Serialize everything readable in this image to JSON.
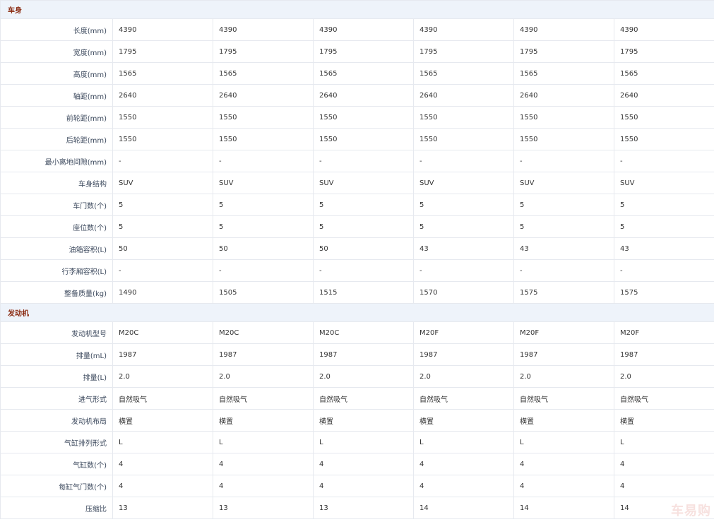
{
  "watermark": "车易购",
  "sections": [
    {
      "title": "车身",
      "rows": [
        {
          "label": "长度(mm)",
          "values": [
            "4390",
            "4390",
            "4390",
            "4390",
            "4390",
            "4390"
          ]
        },
        {
          "label": "宽度(mm)",
          "values": [
            "1795",
            "1795",
            "1795",
            "1795",
            "1795",
            "1795"
          ]
        },
        {
          "label": "高度(mm)",
          "values": [
            "1565",
            "1565",
            "1565",
            "1565",
            "1565",
            "1565"
          ]
        },
        {
          "label": "轴距(mm)",
          "values": [
            "2640",
            "2640",
            "2640",
            "2640",
            "2640",
            "2640"
          ]
        },
        {
          "label": "前轮距(mm)",
          "values": [
            "1550",
            "1550",
            "1550",
            "1550",
            "1550",
            "1550"
          ]
        },
        {
          "label": "后轮距(mm)",
          "values": [
            "1550",
            "1550",
            "1550",
            "1550",
            "1550",
            "1550"
          ]
        },
        {
          "label": "最小离地间隙(mm)",
          "values": [
            "-",
            "-",
            "-",
            "-",
            "-",
            "-"
          ]
        },
        {
          "label": "车身结构",
          "values": [
            "SUV",
            "SUV",
            "SUV",
            "SUV",
            "SUV",
            "SUV"
          ]
        },
        {
          "label": "车门数(个)",
          "values": [
            "5",
            "5",
            "5",
            "5",
            "5",
            "5"
          ]
        },
        {
          "label": "座位数(个)",
          "values": [
            "5",
            "5",
            "5",
            "5",
            "5",
            "5"
          ]
        },
        {
          "label": "油箱容积(L)",
          "values": [
            "50",
            "50",
            "50",
            "43",
            "43",
            "43"
          ]
        },
        {
          "label": "行李厢容积(L)",
          "values": [
            "-",
            "-",
            "-",
            "-",
            "-",
            "-"
          ]
        },
        {
          "label": "整备质量(kg)",
          "values": [
            "1490",
            "1505",
            "1515",
            "1570",
            "1575",
            "1575"
          ]
        }
      ]
    },
    {
      "title": "发动机",
      "rows": [
        {
          "label": "发动机型号",
          "values": [
            "M20C",
            "M20C",
            "M20C",
            "M20F",
            "M20F",
            "M20F"
          ]
        },
        {
          "label": "排量(mL)",
          "values": [
            "1987",
            "1987",
            "1987",
            "1987",
            "1987",
            "1987"
          ]
        },
        {
          "label": "排量(L)",
          "values": [
            "2.0",
            "2.0",
            "2.0",
            "2.0",
            "2.0",
            "2.0"
          ]
        },
        {
          "label": "进气形式",
          "values": [
            "自然吸气",
            "自然吸气",
            "自然吸气",
            "自然吸气",
            "自然吸气",
            "自然吸气"
          ]
        },
        {
          "label": "发动机布局",
          "values": [
            "横置",
            "横置",
            "横置",
            "横置",
            "横置",
            "横置"
          ]
        },
        {
          "label": "气缸排列形式",
          "values": [
            "L",
            "L",
            "L",
            "L",
            "L",
            "L"
          ]
        },
        {
          "label": "气缸数(个)",
          "values": [
            "4",
            "4",
            "4",
            "4",
            "4",
            "4"
          ]
        },
        {
          "label": "每缸气门数(个)",
          "values": [
            "4",
            "4",
            "4",
            "4",
            "4",
            "4"
          ]
        },
        {
          "label": "压缩比",
          "values": [
            "13",
            "13",
            "13",
            "14",
            "14",
            "14"
          ]
        }
      ]
    }
  ]
}
